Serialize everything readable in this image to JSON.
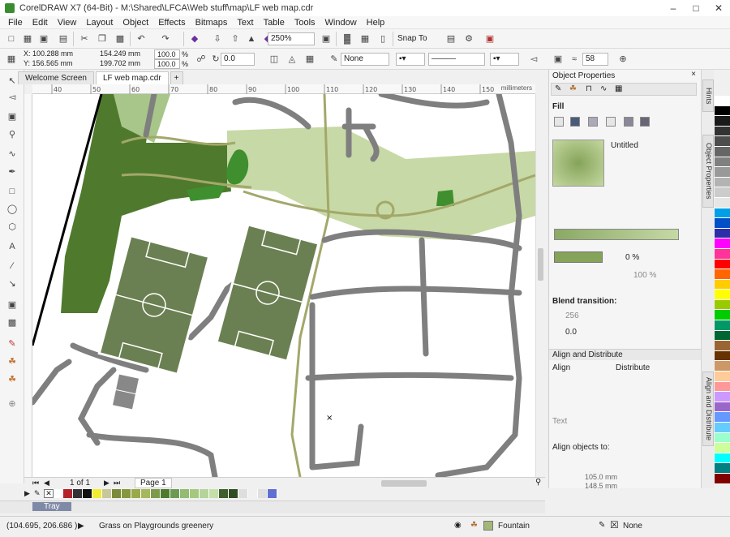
{
  "window": {
    "title": "CorelDRAW X7 (64-Bit) - M:\\Shared\\LFCA\\Web stuff\\map\\LF web map.cdr"
  },
  "menu": [
    "File",
    "Edit",
    "View",
    "Layout",
    "Object",
    "Effects",
    "Bitmaps",
    "Text",
    "Table",
    "Tools",
    "Window",
    "Help"
  ],
  "toolbar": {
    "zoom": "250%",
    "snap_label": "Snap To"
  },
  "propbar": {
    "x": "X: 100.288 mm",
    "y": "Y: 156.565 mm",
    "w": "154.249 mm",
    "h": "199.702 mm",
    "sx": "100.0",
    "sy": "100.0",
    "pct": "%",
    "angle": "0.0",
    "outline": "None",
    "nib": "58"
  },
  "tabs": [
    "Welcome Screen",
    "LF web map.cdr"
  ],
  "ruler": {
    "marks": [
      "40",
      "50",
      "60",
      "70",
      "80",
      "90",
      "100",
      "110",
      "120",
      "130",
      "140",
      "150"
    ],
    "units": "millimeters"
  },
  "page_nav": {
    "count": "1 of 1",
    "page": "Page 1"
  },
  "tray": {
    "label": "Tray"
  },
  "status": {
    "coords": "(104.695, 206.686 )",
    "object": "Grass on Playgrounds greenery",
    "fill": "Fountain",
    "outline": "None"
  },
  "panel": {
    "title": "Object Properties",
    "fill_section": "Fill",
    "fill_name": "Untitled",
    "opacity1": "0 %",
    "opacity2": "100 %",
    "blend_title": "Blend transition:",
    "blend_steps": "256",
    "blend_acc": "0.0",
    "align_title": "Align and Distribute",
    "align_label": "Align",
    "distribute_label": "Distribute",
    "text_label": "Text",
    "align_to": "Align objects to:",
    "pos1": "105.0 mm",
    "pos2": "148.5 mm"
  },
  "dockers": [
    "Hints",
    "Object Properties",
    "Align and Distribute"
  ],
  "colors": {
    "dark_green": "#4f7a2e",
    "light_green": "#c7d9a6",
    "path": "#a3a86a",
    "road": "#7f7f7f",
    "pitch": "#6b8052"
  },
  "palette_h": [
    "#ffffff",
    "#b5232a",
    "#333333",
    "#111111",
    "#f2ec31",
    "#c8c79a",
    "#7b8b3a",
    "#86973f",
    "#9aa94a",
    "#a6b85d",
    "#7d9a4b",
    "#4f7a2e",
    "#6d9a52",
    "#93bb71",
    "#a4c97e",
    "#b5d49a",
    "#c5dfa8",
    "#3f5f2c",
    "#2f4d24",
    "#dedede",
    "#f0f0f0",
    "#e0e0e0",
    "#5f6fd2"
  ],
  "palette_v": [
    "#ffffff",
    "#000000",
    "#1a1a1a",
    "#333333",
    "#4d4d4d",
    "#666666",
    "#808080",
    "#999999",
    "#b3b3b3",
    "#cccccc",
    "#e6e6e6",
    "#00a0e8",
    "#0050c8",
    "#2e2ea8",
    "#ff00ff",
    "#ff3399",
    "#ff0000",
    "#ff6600",
    "#ffcc00",
    "#ffff00",
    "#99cc00",
    "#00cc00",
    "#009966",
    "#006633",
    "#996633",
    "#663300",
    "#cc9966",
    "#ffcc99",
    "#ff9999",
    "#cc99ff",
    "#9966cc",
    "#6699ff",
    "#66ccff",
    "#99ffcc",
    "#ccff99",
    "#00ffff",
    "#008080",
    "#800000"
  ]
}
